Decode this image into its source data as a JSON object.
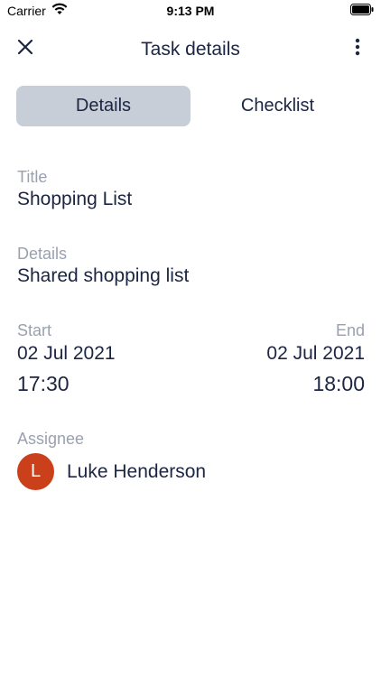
{
  "status_bar": {
    "carrier": "Carrier",
    "time": "9:13 PM"
  },
  "nav": {
    "title": "Task details",
    "close_icon": "close-icon",
    "more_icon": "more-vertical-icon"
  },
  "tabs": [
    {
      "label": "Details",
      "active": true
    },
    {
      "label": "Checklist",
      "active": false
    }
  ],
  "task": {
    "title_label": "Title",
    "title": "Shopping List",
    "details_label": "Details",
    "details": "Shared shopping list",
    "start_label": "Start",
    "start_date": "02 Jul 2021",
    "start_time": "17:30",
    "end_label": "End",
    "end_date": "02 Jul 2021",
    "end_time": "18:00",
    "assignee_label": "Assignee",
    "assignee_initial": "L",
    "assignee_name": "Luke Henderson"
  },
  "colors": {
    "text_primary": "#1c2542",
    "text_secondary": "#9aa1ae",
    "active_tab_bg": "#c8ced8",
    "avatar_bg": "#c9401a"
  }
}
